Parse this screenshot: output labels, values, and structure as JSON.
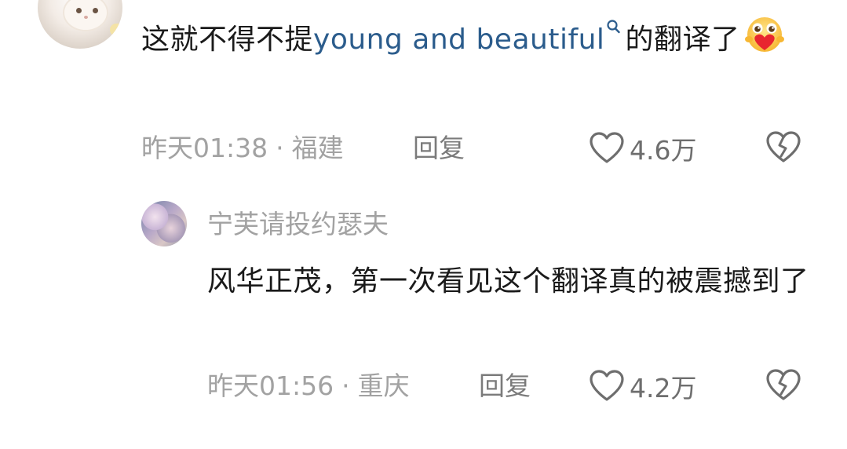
{
  "parent_comment": {
    "text_before": "这就不得不提",
    "keyword": "young and beautiful",
    "text_after": "的翻译了",
    "emoji": "heart-face-emoji",
    "time": "昨天01:38",
    "separator": "·",
    "location": "福建",
    "reply_label": "回复",
    "like_count": "4.6万"
  },
  "reply_comment": {
    "username": "宁芙请投约瑟夫",
    "text": "风华正茂，第一次看见这个翻译真的被震撼到了",
    "time": "昨天01:56",
    "separator": "·",
    "location": "重庆",
    "reply_label": "回复",
    "like_count": "4.2万"
  },
  "icons": {
    "like": "heart-outline-icon",
    "dislike": "broken-heart-icon",
    "keyword_search": "search-icon"
  },
  "colors": {
    "link": "#2b5c8c",
    "meta": "#a2a2a2",
    "text": "#1a1a1a"
  }
}
